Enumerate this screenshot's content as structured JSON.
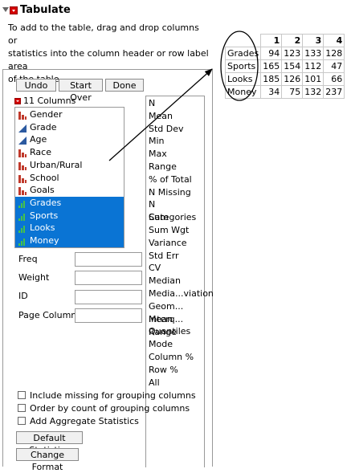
{
  "header": {
    "title": "Tabulate"
  },
  "instructions": [
    "To add to the table, drag and drop columns or",
    "statistics into the column header or row label area",
    "of the table."
  ],
  "buttons": {
    "undo": "Undo",
    "start_over": "Start Over",
    "done": "Done"
  },
  "columns": {
    "header": "11 Columns",
    "items": [
      {
        "label": "Gender",
        "type": "nominal",
        "selected": false
      },
      {
        "label": "Grade",
        "type": "ordinal",
        "selected": false
      },
      {
        "label": "Age",
        "type": "ordinal",
        "selected": false
      },
      {
        "label": "Race",
        "type": "nominal",
        "selected": false
      },
      {
        "label": "Urban/Rural",
        "type": "nominal",
        "selected": false
      },
      {
        "label": "School",
        "type": "nominal",
        "selected": false
      },
      {
        "label": "Goals",
        "type": "nominal",
        "selected": false
      },
      {
        "label": "Grades",
        "type": "continuous",
        "selected": true
      },
      {
        "label": "Sports",
        "type": "continuous",
        "selected": true
      },
      {
        "label": "Looks",
        "type": "continuous",
        "selected": true
      },
      {
        "label": "Money",
        "type": "continuous",
        "selected": true
      }
    ]
  },
  "statistics": [
    "N",
    "Mean",
    "Std Dev",
    "Min",
    "Max",
    "Range",
    "% of Total",
    "N Missing",
    "N Categories",
    "Sum",
    "Sum Wgt",
    "Variance",
    "Std Err",
    "CV",
    "Median",
    "Media...viation",
    "Geom... Mean",
    "Interq... Range",
    "Quantiles",
    "Mode",
    "Column %",
    "Row %",
    "All"
  ],
  "roles": {
    "freq": "Freq",
    "weight": "Weight",
    "id": "ID",
    "page_column": "Page Column"
  },
  "options": [
    "Include missing for grouping columns",
    "Order by count of grouping columns",
    "Add Aggregate Statistics"
  ],
  "bottom_buttons": {
    "default_statistics": "Default Statistics",
    "change_format": "Change Format"
  },
  "table": {
    "col_headers": [
      "1",
      "2",
      "3",
      "4"
    ],
    "rows": [
      {
        "label": "Grades",
        "values": [
          "94",
          "123",
          "133",
          "128"
        ]
      },
      {
        "label": "Sports",
        "values": [
          "165",
          "154",
          "112",
          "47"
        ]
      },
      {
        "label": "Looks",
        "values": [
          "185",
          "126",
          "101",
          "66"
        ]
      },
      {
        "label": "Money",
        "values": [
          "34",
          "75",
          "132",
          "237"
        ]
      }
    ]
  },
  "colors": {
    "selection": "#0a74d4",
    "nominal_icon": "#c0392b",
    "ordinal_icon": "#2c5aa0",
    "continuous_icon": "#46c24a",
    "red_menu": "#d40000"
  },
  "icons": {
    "disclosure": "disclosure-triangle-icon",
    "red_menu": "red-triangle-menu-icon"
  }
}
